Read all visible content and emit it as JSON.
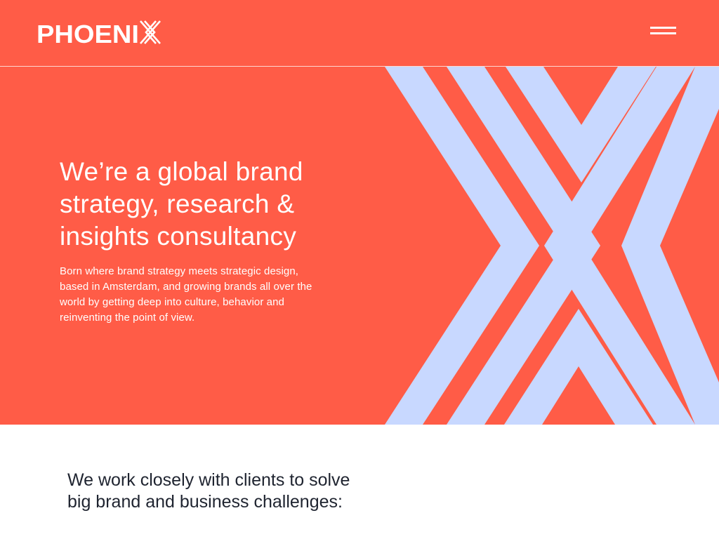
{
  "colors": {
    "brand_coral": "#FF5C47",
    "accent_lavender": "#C8D8FF",
    "text_dark": "#1f2430",
    "white": "#ffffff"
  },
  "header": {
    "logo_text": "PHOENIX",
    "menu_icon": "hamburger-menu-icon"
  },
  "hero": {
    "headline": "We’re a global brand strategy, research & insights consultancy",
    "description": "Born where brand strategy meets strategic design, based in Amsterdam, and growing brands all over the world by getting deep into culture, behavior and reinventing the point of view.",
    "graphic": "chevron-x-pattern"
  },
  "intro": {
    "heading": "We work closely with clients to solve big brand and business challenges:"
  }
}
